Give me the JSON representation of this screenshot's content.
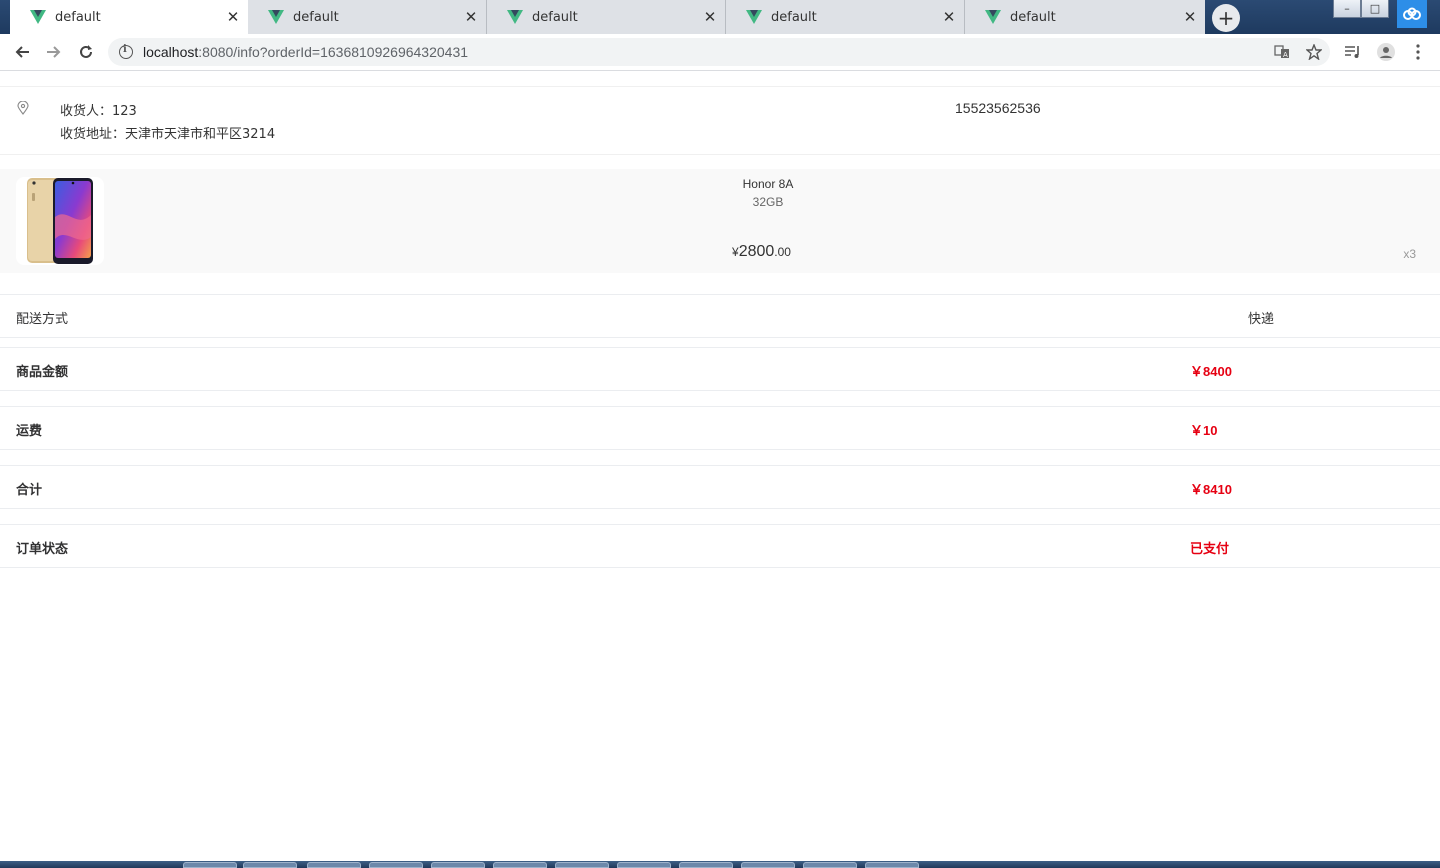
{
  "browser": {
    "tabs": [
      {
        "title": "default",
        "active": true
      },
      {
        "title": "default",
        "active": false
      },
      {
        "title": "default",
        "active": false
      },
      {
        "title": "default",
        "active": false
      },
      {
        "title": "default",
        "active": false
      }
    ],
    "url_host": "localhost",
    "url_rest": ":8080/info?orderId=1636810926964320431",
    "icons": {
      "back": "arrow-left-icon",
      "forward": "arrow-right-icon",
      "reload": "reload-icon",
      "translate": "translate-icon",
      "bookmark": "star-icon",
      "media": "media-control-icon",
      "profile": "avatar-icon",
      "menu": "kebab-menu-icon"
    }
  },
  "address": {
    "consignee": "收货人：123",
    "full_address": "收货地址：天津市天津市和平区3214",
    "phone": "15523562536"
  },
  "goods": {
    "title": "Honor 8A",
    "spec": "32GB",
    "price_symbol": "¥",
    "price_integer": "2800",
    "price_decimal": ".00",
    "quantity": "x3"
  },
  "rows": {
    "delivery_label": "配送方式",
    "delivery_value": "快递",
    "goods_amount_label": "商品金额",
    "goods_amount_value": "￥8400",
    "freight_label": "运费",
    "freight_value": "￥10",
    "total_label": "合计",
    "total_value": "￥8410",
    "status_label": "订单状态",
    "status_value": "已支付"
  },
  "colors": {
    "accent_red": "#e60012",
    "vue_green": "#41b883",
    "vue_dark": "#35495e"
  }
}
